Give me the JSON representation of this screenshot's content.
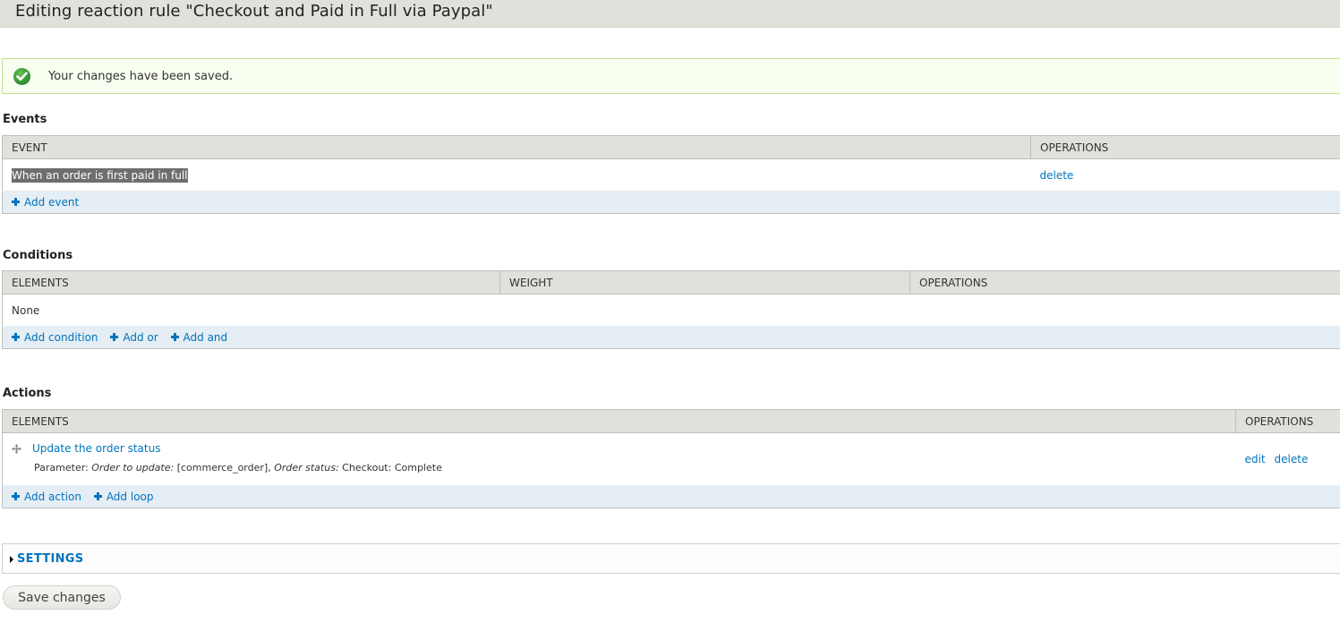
{
  "header": {
    "title": "Editing reaction rule \"Checkout and Paid in Full via Paypal\""
  },
  "message": {
    "icon": "check-circle-icon",
    "text": "Your changes have been saved.",
    "status_color": "#3f9a3f"
  },
  "events": {
    "title": "Events",
    "columns": [
      "EVENT",
      "OPERATIONS"
    ],
    "rows": [
      {
        "event": "When an order is first paid in full",
        "operations": [
          "delete"
        ]
      }
    ],
    "add_links": [
      "Add event"
    ]
  },
  "conditions": {
    "title": "Conditions",
    "columns": [
      "ELEMENTS",
      "WEIGHT",
      "OPERATIONS"
    ],
    "empty_text": "None",
    "add_links": [
      "Add condition",
      "Add or",
      "Add and"
    ]
  },
  "actions": {
    "title": "Actions",
    "columns": [
      "ELEMENTS",
      "OPERATIONS"
    ],
    "rows": [
      {
        "label": "Update the order status",
        "param_label": "Parameter:",
        "param_1_name": "Order to update:",
        "param_1_value": "[commerce_order],",
        "param_2_name": "Order status:",
        "param_2_value": "Checkout: Complete",
        "operations": [
          "edit",
          "delete"
        ]
      }
    ],
    "add_links": [
      "Add action",
      "Add loop"
    ]
  },
  "settings": {
    "label": "SETTINGS",
    "expanded": false
  },
  "buttons": {
    "save": "Save changes"
  },
  "colors": {
    "link": "#0074bd",
    "header_bg": "#e1e1dc",
    "add_row_bg": "#e5eef4",
    "message_bg": "#f8fff0"
  }
}
